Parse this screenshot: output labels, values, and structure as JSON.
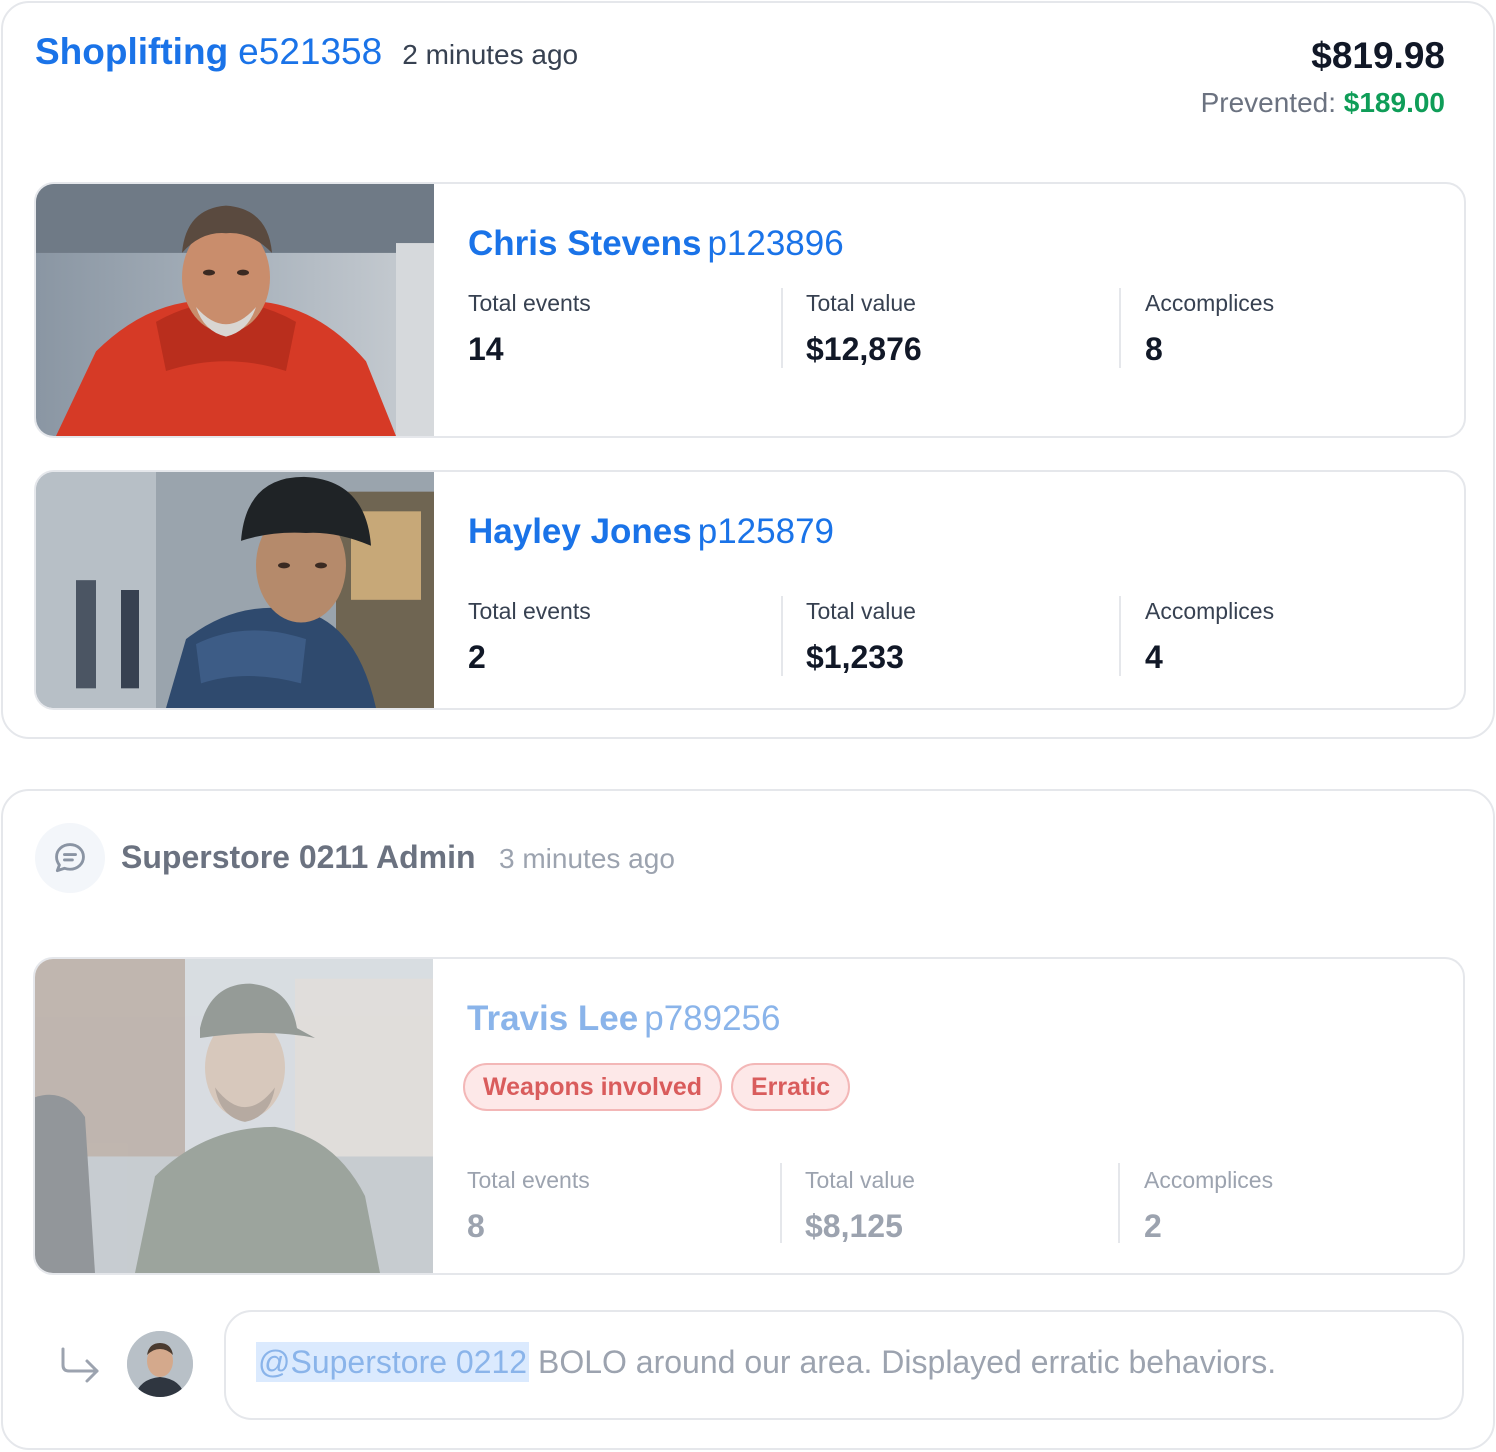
{
  "event": {
    "type": "Shoplifting",
    "id": "e521358",
    "time": "2 minutes ago",
    "amount": "$819.98",
    "prevented_label": "Prevented:",
    "prevented_value": "$189.00"
  },
  "people": [
    {
      "name": "Chris Stevens",
      "id": "p123896",
      "stats": [
        {
          "label": "Total events",
          "value": "14"
        },
        {
          "label": "Total value",
          "value": "$12,876"
        },
        {
          "label": "Accomplices",
          "value": "8"
        }
      ]
    },
    {
      "name": "Hayley Jones",
      "id": "p125879",
      "stats": [
        {
          "label": "Total events",
          "value": "2"
        },
        {
          "label": "Total value",
          "value": "$1,233"
        },
        {
          "label": "Accomplices",
          "value": "4"
        }
      ]
    }
  ],
  "comment": {
    "author": "Superstore 0211 Admin",
    "time": "3 minutes ago",
    "icon": "chat-bubble-icon",
    "person": {
      "name": "Travis Lee",
      "id": "p789256",
      "tags": [
        "Weapons involved",
        "Erratic"
      ],
      "stats": [
        {
          "label": "Total events",
          "value": "8"
        },
        {
          "label": "Total value",
          "value": "$8,125"
        },
        {
          "label": "Accomplices",
          "value": "2"
        }
      ]
    },
    "reply": {
      "mention": "@Superstore 0212",
      "text": " BOLO around our area. Displayed erratic behaviors."
    }
  },
  "colors": {
    "accent": "#1a73e8",
    "prevented": "#0f9d58",
    "tag_text": "#d95c5c",
    "tag_bg": "#fde8e8"
  }
}
